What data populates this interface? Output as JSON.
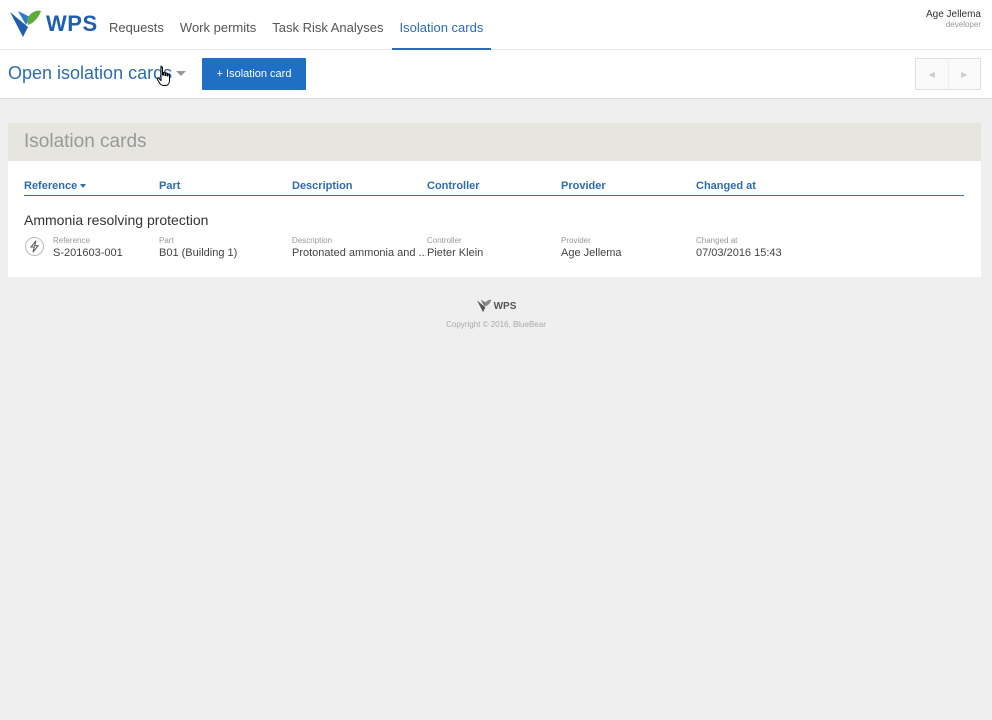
{
  "app": {
    "name": "WPS"
  },
  "nav": {
    "items": [
      {
        "label": "Requests"
      },
      {
        "label": "Work permits"
      },
      {
        "label": "Task Risk Analyses"
      },
      {
        "label": "Isolation cards"
      }
    ],
    "active": "Isolation cards"
  },
  "user": {
    "name": "Age Jellema",
    "role": "developer"
  },
  "toolbar": {
    "view_title": "Open isolation cards",
    "add_button": "+ Isolation card"
  },
  "panel": {
    "title": "Isolation cards",
    "columns": [
      "Reference",
      "Part",
      "Description",
      "Controller",
      "Provider",
      "Changed at"
    ],
    "sorted_by": "Reference",
    "rows": [
      {
        "title": "Ammonia resolving protection",
        "icon": "lightning-icon",
        "reference": "S-201603-001",
        "part": "B01 (Building 1)",
        "description": "Protonated ammonia and ...",
        "controller": "Pieter Klein",
        "provider": "Age Jellema",
        "changed_at": "07/03/2016 15:43"
      }
    ]
  },
  "footer": {
    "logo": "WPS",
    "copyright": "Copyright © 2016, BlueBear"
  },
  "colors": {
    "accent": "#2b6cb5",
    "button": "#1f6fc5",
    "logo_green": "#5dab3a",
    "background": "#efefef"
  }
}
